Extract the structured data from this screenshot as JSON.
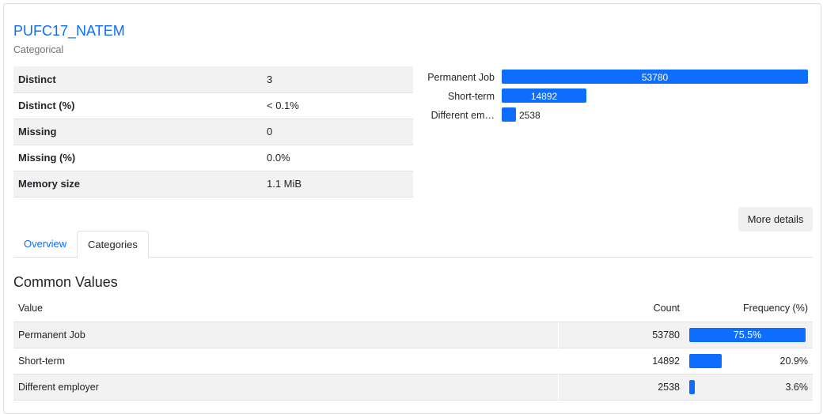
{
  "variable": {
    "name": "PUFC17_NATEM",
    "type": "Categorical"
  },
  "stats": [
    {
      "label": "Distinct",
      "value": "3"
    },
    {
      "label": "Distinct (%)",
      "value": "< 0.1%"
    },
    {
      "label": "Missing",
      "value": "0"
    },
    {
      "label": "Missing (%)",
      "value": "0.0%"
    },
    {
      "label": "Memory size",
      "value": "1.1 MiB"
    }
  ],
  "mini_chart": {
    "type": "bar",
    "categories": [
      "Permanent Job",
      "Short-term",
      "Different em…"
    ],
    "values": [
      53780,
      14892,
      2538
    ],
    "value_labels": [
      "53780",
      "14892",
      "2538"
    ]
  },
  "buttons": {
    "more_details": "More details"
  },
  "tabs": [
    {
      "label": "Overview",
      "active": false
    },
    {
      "label": "Categories",
      "active": true
    }
  ],
  "common_values": {
    "title": "Common Values",
    "headers": {
      "value": "Value",
      "count": "Count",
      "frequency": "Frequency (%)"
    },
    "rows": [
      {
        "value": "Permanent Job",
        "count": "53780",
        "frequency": "75.5%",
        "fraction": 0.755
      },
      {
        "value": "Short-term",
        "count": "14892",
        "frequency": "20.9%",
        "fraction": 0.209
      },
      {
        "value": "Different employer",
        "count": "2538",
        "frequency": "3.6%",
        "fraction": 0.036
      }
    ]
  },
  "colors": {
    "accent": "#0d6efd",
    "row_alt": "#f2f2f2"
  }
}
